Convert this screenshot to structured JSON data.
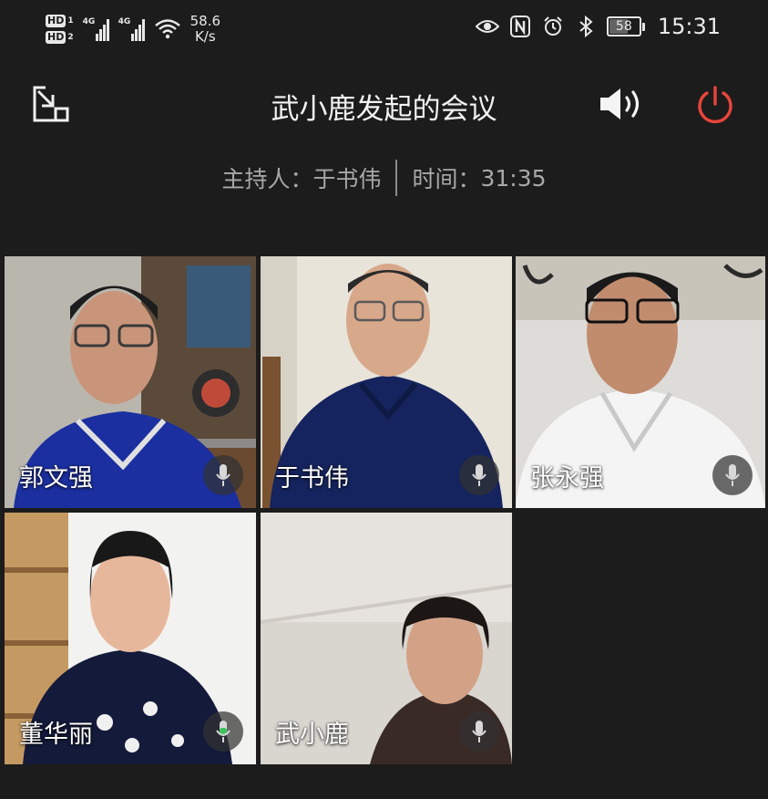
{
  "status_bar": {
    "hd1": "HD",
    "hd1_sub": "1",
    "hd2": "HD",
    "hd2_sub": "2",
    "net1": "4G",
    "net2": "4G",
    "speed_value": "58.6",
    "speed_unit": "K/s",
    "battery": "58",
    "time": "15:31",
    "icons": [
      "eye-icon",
      "nfc-icon",
      "alarm-icon",
      "bluetooth-icon"
    ]
  },
  "meeting": {
    "title": "武小鹿发起的会议",
    "host_label": "主持人：",
    "host_name": "于书伟",
    "time_label": "时间：",
    "elapsed": "31:35"
  },
  "participants": [
    {
      "name": "郭文强",
      "mic": "muted-idle"
    },
    {
      "name": "于书伟",
      "mic": "idle"
    },
    {
      "name": "张永强",
      "mic": "idle"
    },
    {
      "name": "董华丽",
      "mic": "speaking"
    },
    {
      "name": "武小鹿",
      "mic": "idle"
    }
  ],
  "colors": {
    "background": "#1c1c1c",
    "hangup_red": "#e8453c",
    "speaking_green": "#3cc35a"
  }
}
